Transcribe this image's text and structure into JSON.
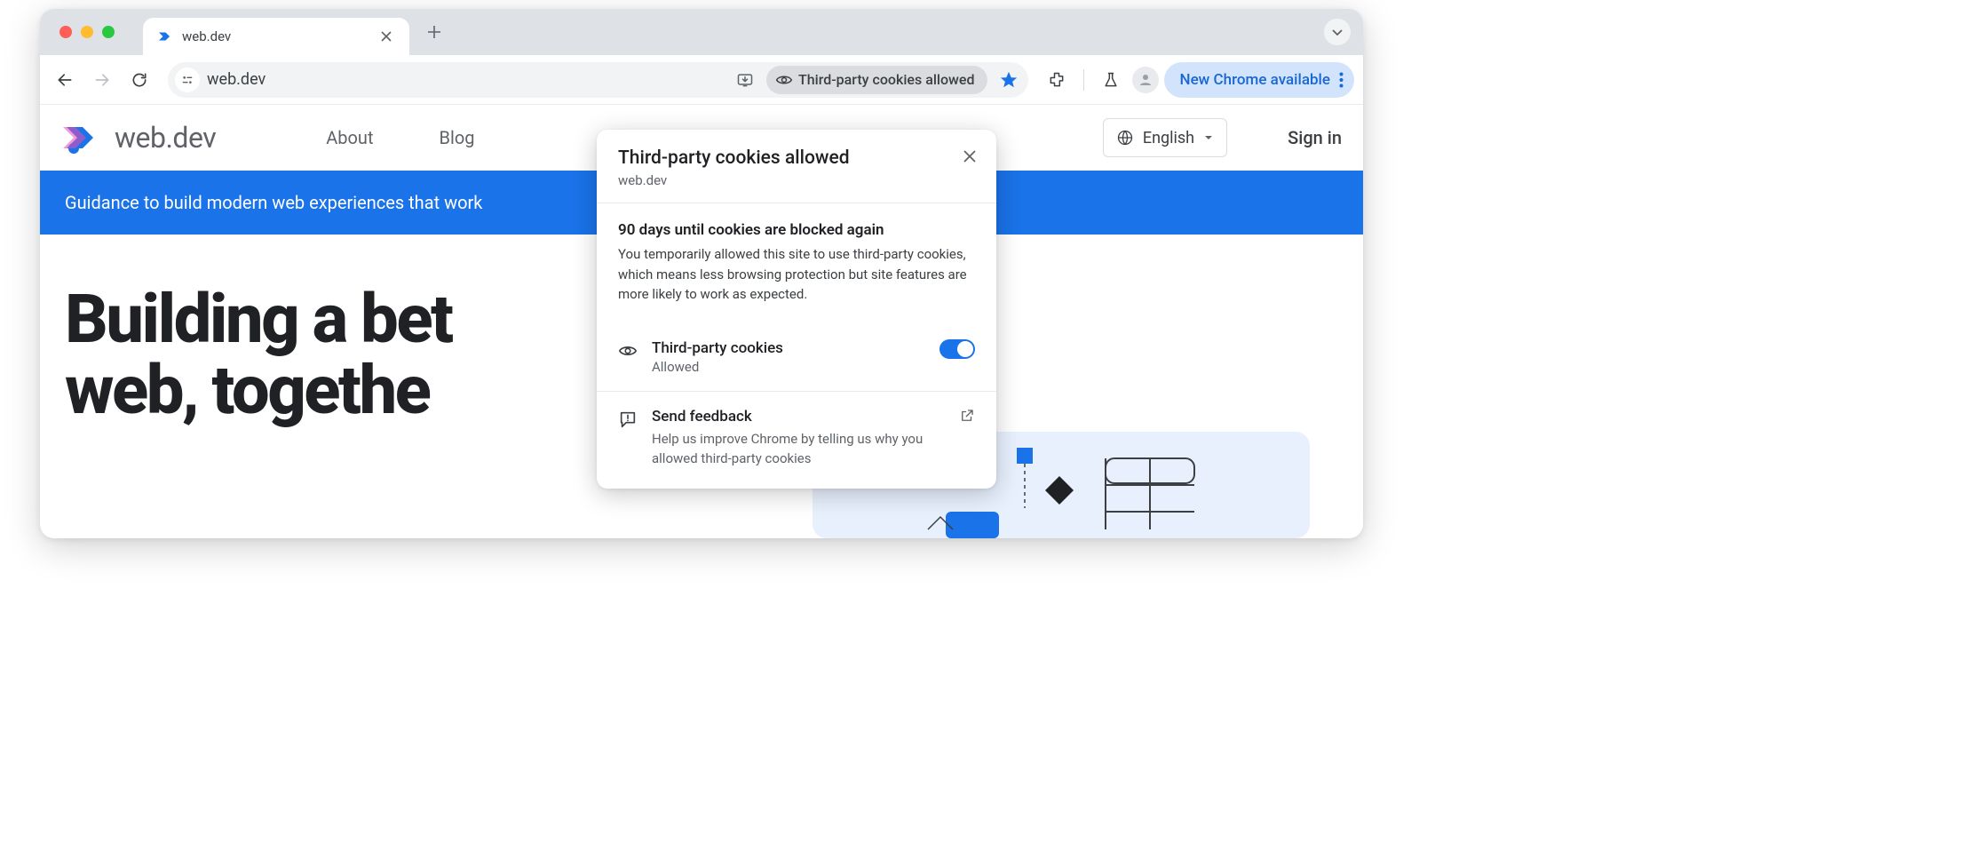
{
  "window": {
    "tab_title": "web.dev"
  },
  "toolbar": {
    "url": "web.dev",
    "cookie_chip": "Third-party cookies allowed",
    "update_label": "New Chrome available"
  },
  "site_header": {
    "brand": "web.dev",
    "nav": {
      "about": "About",
      "blog": "Blog"
    },
    "language": "English",
    "signin": "Sign in"
  },
  "banner": {
    "text": "Guidance to build modern web experiences that work"
  },
  "hero": {
    "line1": "Building a bet",
    "line2": "web, togethe"
  },
  "popover": {
    "title": "Third-party cookies allowed",
    "domain": "web.dev",
    "countdown_title": "90 days until cookies are blocked again",
    "countdown_body": "You temporarily allowed this site to use third-party cookies, which means less browsing protection but site features are more likely to work as expected.",
    "toggle_title": "Third-party cookies",
    "toggle_status": "Allowed",
    "feedback_title": "Send feedback",
    "feedback_body": "Help us improve Chrome by telling us why you allowed third-party cookies"
  }
}
